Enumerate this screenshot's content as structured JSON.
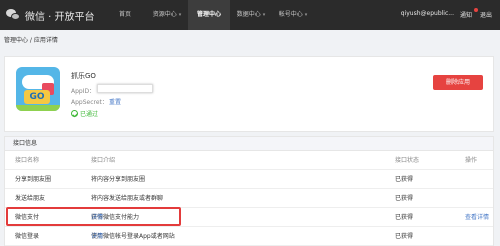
{
  "topbar": {
    "logo_text": "微信 · 开放平台",
    "nav": [
      {
        "label": "首页",
        "active": false,
        "has_arrow": false
      },
      {
        "label": "资源中心",
        "active": false,
        "has_arrow": true
      },
      {
        "label": "管理中心",
        "active": true,
        "has_arrow": false
      },
      {
        "label": "数据中心",
        "active": false,
        "has_arrow": true
      },
      {
        "label": "帐号中心",
        "active": false,
        "has_arrow": true
      }
    ],
    "nav_arrow": "▾",
    "user": "qiyush@epublic...",
    "notice": "通知",
    "logout": "退出"
  },
  "breadcrumb": "管理中心 / 应用详情",
  "app": {
    "name": "抓乐GO",
    "icon_text": "GO",
    "appid_label": "AppID：",
    "secret_label": "AppSecret：",
    "reset_label": "重置",
    "status": "已通过",
    "delete_label": "删除应用"
  },
  "interfaces": {
    "title": "接口信息",
    "headers": [
      "接口名称",
      "接口介绍",
      "接口状态",
      "操作"
    ],
    "rows": [
      {
        "name": "分享到朋友圈",
        "intro": "将内容分享到朋友圈",
        "intro_link": "",
        "status": "已获得",
        "action": ""
      },
      {
        "name": "发送给朋友",
        "intro": "将内容发送给朋友或者群聊",
        "intro_link": "",
        "status": "已获得",
        "action": ""
      },
      {
        "name": "微信支付",
        "intro": "获得微信支付能力",
        "intro_link": "详情",
        "status": "已获得",
        "action": "查看详情"
      },
      {
        "name": "微信登录",
        "intro": "使用微信帐号登录App或者网站",
        "intro_link": "详情",
        "status": "已获得",
        "action": ""
      }
    ]
  },
  "colors": {
    "topbar_bg": "#2b2b2b",
    "link": "#4a7bc8",
    "success": "#3fb838",
    "danger": "#e64340",
    "highlight_border": "#e33b3b"
  }
}
